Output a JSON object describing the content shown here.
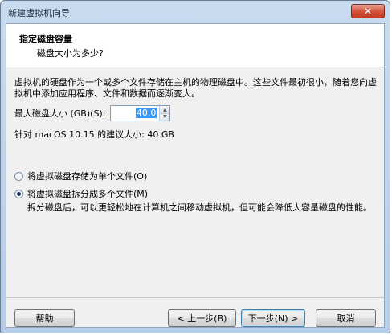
{
  "window": {
    "title": "新建虚拟机向导",
    "close_glyph": "✕"
  },
  "header": {
    "title": "指定磁盘容量",
    "subtitle": "磁盘大小为多少?"
  },
  "body": {
    "description": "虚拟机的硬盘作为一个或多个文件存储在主机的物理磁盘中。这些文件最初很小，随着您向虚拟机中添加应用程序、文件和数据而逐渐变大。",
    "max_size_label": "最大磁盘大小 (GB)(S):",
    "max_size_value": "40.0",
    "recommended": "针对 macOS 10.15 的建议大小: 40 GB",
    "options": [
      {
        "label": "将虚拟磁盘存储为单个文件(O)",
        "selected": false
      },
      {
        "label": "将虚拟磁盘拆分成多个文件(M)",
        "selected": true
      }
    ],
    "split_note": "拆分磁盘后，可以更轻松地在计算机之间移动虚拟机，但可能会降低大容量磁盘的性能。"
  },
  "buttons": {
    "help": "帮助",
    "back": "< 上一步(B)",
    "next": "下一步(N) >",
    "cancel": "取消"
  }
}
